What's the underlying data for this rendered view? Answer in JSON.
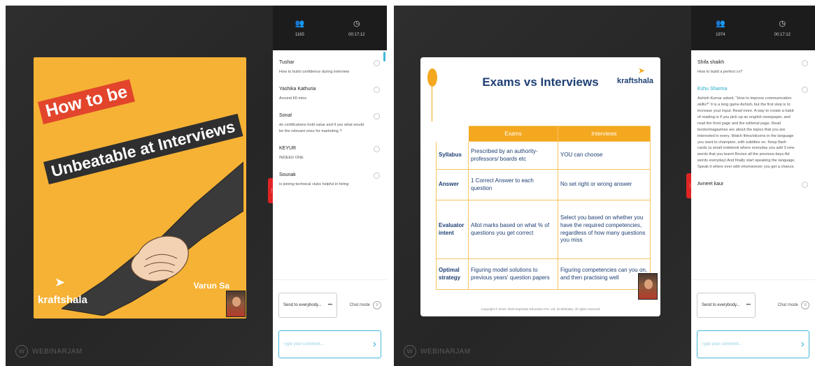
{
  "screen1": {
    "stats": {
      "attendees": "1165",
      "timer": "00:17:12"
    },
    "messages": [
      {
        "name": "Tushar",
        "text": "How to build confidence during interview"
      },
      {
        "name": "Yashika Kathuria",
        "text": "Around 60 mins"
      },
      {
        "name": "Sonal",
        "text": "do certifications hold value and if yes what would be the relevant ones for marketing ?"
      },
      {
        "name": "KEYUR",
        "text": "INDEED ONE"
      },
      {
        "name": "Sounak",
        "text": "is joining technical clubs helpful in hiring"
      }
    ],
    "send_to": "Send to everybody...",
    "chat_mode": "Chat mode",
    "comment_placeholder": "Type your comment...",
    "slide": {
      "line1": "How to be",
      "line2": "Unbeatable at Interviews",
      "logo_text": "kraftshala",
      "presenter": "Varun Sa"
    },
    "watermark": "WEBINARJAM"
  },
  "screen2": {
    "stats": {
      "attendees": "1974",
      "timer": "00:17:12"
    },
    "messages": [
      {
        "name": "Shifa shaikh",
        "text": "How to build a perfect cv?"
      },
      {
        "name": "Eshu Sharma",
        "text": "Ashish Kumar asked, \"How to improve communication skills?\" It is a long game Ashish, but the first step is to increase your input. Read more. A way to create a habit of reading is if you pick up an english newspaper, and read the front page and the editorial page. Read books/magazines are about the topics that you are interested in every. Watch films/sitcoms in the language you want to champion, with subtitles on. Keep flash cards (a small notebook where everyday you add 3 new words that you learnt.Revise all the previous days.Ad words everyday) And finally start speaking the language. Speak it where ever with ehomsoever you get a chance."
      },
      {
        "name": "Avneet kaur",
        "text": ""
      }
    ],
    "send_to": "Send to everybody...",
    "chat_mode": "Chat mode",
    "comment_placeholder": "Type your comment...",
    "slide": {
      "title": "Exams vs Interviews",
      "logo_text": "kraftshala",
      "table": {
        "headers": [
          "",
          "Exams",
          "Interviews"
        ],
        "rows": [
          [
            "Syllabus",
            "Prescribed by an authority- professors/ boards etc",
            "YOU can choose"
          ],
          [
            "Answer",
            "1 Correct Answer to each question",
            "No set right or wrong answer"
          ],
          [
            "Evaluator intent",
            "Allot marks based on what % of questions you get correct",
            "Select you based on whether you have the required competencies, regardless of how many questions you miss"
          ],
          [
            "Optimal strategy",
            "Figuring model solutions to previous years' question papers",
            "Figuring competencies can you on, and then practising well"
          ]
        ]
      },
      "footer": "Copyright © 2019- 2020 Expertise Education Pvt. Ltd. (Kraftshala). All rights reserved"
    },
    "watermark": "WEBINARJAM"
  },
  "colors": {
    "accent": "#42b7d9",
    "slide_orange": "#f6b235",
    "title_navy": "#1e3f73",
    "tab_red": "#e02424"
  }
}
